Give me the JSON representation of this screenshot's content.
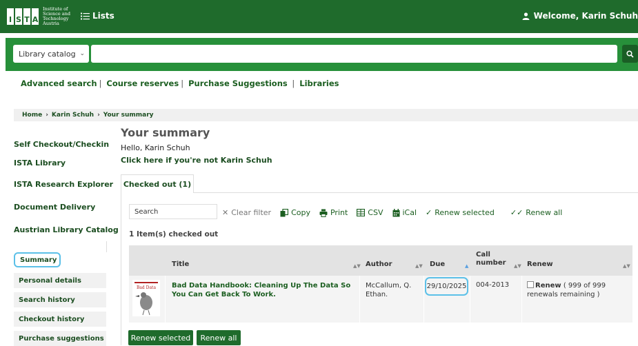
{
  "header": {
    "logo_letters": [
      "I",
      "S",
      "T",
      "A"
    ],
    "logo_lines": [
      "Institute of",
      "Science and",
      "Technology",
      "Austria"
    ],
    "lists_label": "Lists",
    "welcome": "Welcome, Karin Schuh"
  },
  "search": {
    "select_value": "Library catalog",
    "query_value": ""
  },
  "moresearches": [
    "Advanced search",
    "Course reserves",
    "Purchase Suggestions",
    "Libraries"
  ],
  "breadcrumb": [
    "Home",
    "Karin Schuh",
    "Your summary"
  ],
  "sidebar": {
    "links": [
      "Self Checkout/Checkin",
      "ISTA Library",
      "ISTA Research Explorer",
      "Document Delivery",
      "Austrian Library Catalog"
    ],
    "nav": [
      "Summary",
      "Personal details",
      "Search history",
      "Checkout history",
      "Purchase suggestions"
    ]
  },
  "main": {
    "title": "Your summary",
    "hello": "Hello, Karin Schuh",
    "not_user": "Click here if you're not Karin Schuh",
    "tab": "Checked out (1)",
    "filter_placeholder": "Search",
    "tools": {
      "clear": "Clear filter",
      "copy": "Copy",
      "print": "Print",
      "csv": "CSV",
      "ical": "iCal",
      "renew_selected": "Renew selected",
      "renew_all": "Renew all"
    },
    "count": "1 Item(s) checked out",
    "columns": {
      "title": "Title",
      "author": "Author",
      "due": "Due",
      "call1": "Call",
      "call2": "number",
      "renew": "Renew"
    },
    "row": {
      "cover_text": "Bad Data",
      "title": "Bad Data Handbook: Cleaning Up The Data So You Can Get Back To Work.",
      "author": "McCallum, Q. Ethan.",
      "due": "29/10/2025",
      "call_number": "004-2013",
      "renew_link": "Renew",
      "renew_info": "( 999 of 999 renewals remaining )"
    },
    "buttons": {
      "renew_selected": "Renew selected",
      "renew_all": "Renew all"
    }
  },
  "colors": {
    "header_green": "#1f6b2c",
    "search_green": "#27903a",
    "highlight": "#5bc0e8"
  }
}
